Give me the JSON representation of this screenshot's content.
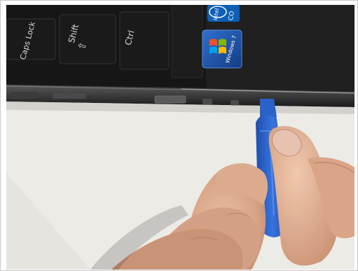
{
  "keys": {
    "caps_lock": "Caps Lock",
    "shift": "Shift",
    "shift_arrow": "⇧",
    "ctrl": "Ctrl"
  },
  "stickers": {
    "windows_label": "Windows 7",
    "intel_text": "intel",
    "intel_sub": "CO"
  },
  "colors": {
    "laptop_body": "#141414",
    "desk_surface": "#efeeea",
    "spudger": "#2a62c8",
    "skin": "#d9a688",
    "windows_sticker": "#1c4e9c",
    "intel_sticker": "#0d5fb5"
  }
}
